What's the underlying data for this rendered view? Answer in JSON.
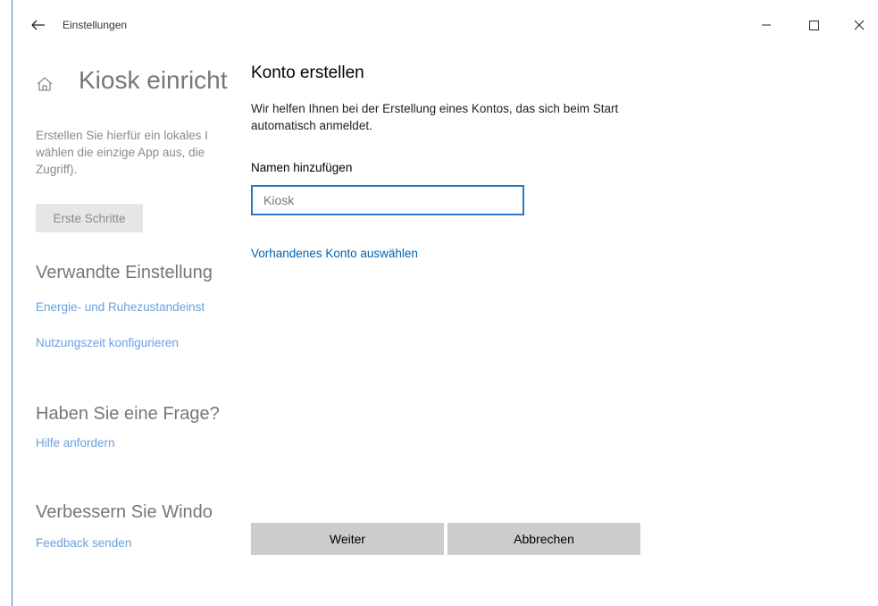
{
  "window": {
    "title": "Einstellungen",
    "icons": {
      "back": "arrow-left-icon",
      "minimize": "minimize-icon",
      "maximize": "maximize-icon",
      "close": "close-icon"
    }
  },
  "background_page": {
    "home_icon": "home-icon",
    "title": "Kiosk einricht",
    "description_lines": [
      "Erstellen Sie hierfür ein lokales I",
      "wählen die einzige App aus, die",
      "Zugriff)."
    ],
    "start_button": "Erste Schritte",
    "related_heading": "Verwandte Einstellung",
    "related_links": [
      "Energie- und Ruhezustandeinst",
      "Nutzungszeit konfigurieren"
    ],
    "question_heading": "Haben Sie eine Frage?",
    "help_link": "Hilfe anfordern",
    "improve_heading": "Verbessern Sie Windo",
    "feedback_link": "Feedback senden"
  },
  "dialog": {
    "title": "Konto erstellen",
    "description": "Wir helfen Ihnen bei der Erstellung eines Kontos, das sich beim Start automatisch anmeldet.",
    "name_label": "Namen hinzufügen",
    "name_placeholder": "Kiosk",
    "name_value": "",
    "existing_account_link": "Vorhandenes Konto auswählen",
    "next_button": "Weiter",
    "cancel_button": "Abbrechen"
  },
  "colors": {
    "accent": "#0063b1",
    "input_border": "#2b79c2",
    "dimmed_link": "#6aa1dd",
    "button_bg": "#cccccc"
  }
}
